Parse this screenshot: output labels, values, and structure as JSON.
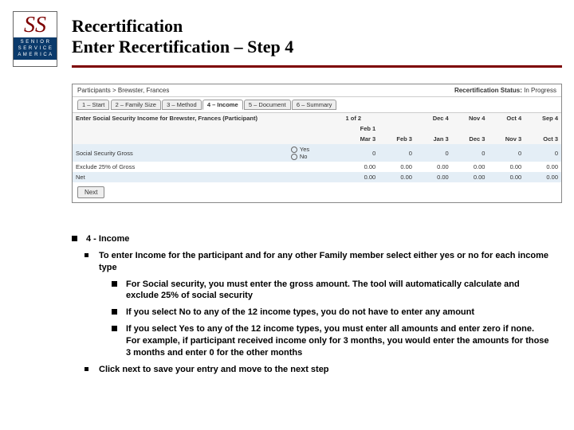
{
  "logo": {
    "mark": "SS",
    "line1": "S E N I O R",
    "line2": "S E R V I C E",
    "line3": "A M E R I C A"
  },
  "title": {
    "line1": "Recertification",
    "line2": "Enter Recertification – Step 4"
  },
  "screenshot": {
    "breadcrumb": "Participants > Brewster, Frances",
    "status_label": "Recertification Status:",
    "status_value": "In Progress",
    "tabs": [
      "1 – Start",
      "2 – Family Size",
      "3 – Method",
      "4 – Income",
      "5 – Document",
      "6 – Summary"
    ],
    "active_tab_index": 3,
    "prompt": "Enter Social Security Income for Brewster, Frances (Participant)",
    "page_of": "1 of 2",
    "months_row1": [
      "Feb 1",
      "",
      "Dec 4",
      "Nov 4",
      "Oct 4",
      "Sep 4"
    ],
    "months_row2": [
      "Mar 3",
      "Feb 3",
      "Jan 3",
      "Dec 3",
      "Nov 3",
      "Oct 3"
    ],
    "row_ssg_label": "Social Security Gross",
    "yes": "Yes",
    "no": "No",
    "row_ssg_vals": [
      "0",
      "0",
      "0",
      "0",
      "0",
      "0"
    ],
    "row_excl_label": "Exclude 25% of Gross",
    "row_excl_vals": [
      "0.00",
      "0.00",
      "0.00",
      "0.00",
      "0.00",
      "0.00"
    ],
    "row_net_label": "Net",
    "row_net_vals": [
      "0.00",
      "0.00",
      "0.00",
      "0.00",
      "0.00",
      "0.00"
    ],
    "next_btn": "Next"
  },
  "notes": {
    "h1": "4 - Income",
    "a": "To enter Income for the participant and for any other Family member select either yes or no for each income type",
    "b": "For Social security, you must enter the gross amount.  The tool will automatically calculate and exclude 25% of social security",
    "c": "If you select No to any of the 12 income types, you do not have to enter any amount",
    "d": "If you select Yes to any of the 12 income types, you must enter all amounts and enter zero if none.  For example, if participant received income only for 3 months, you would enter the amounts for those 3 months and enter 0 for the other months",
    "e": "Click next to save your entry and move to the next step"
  }
}
